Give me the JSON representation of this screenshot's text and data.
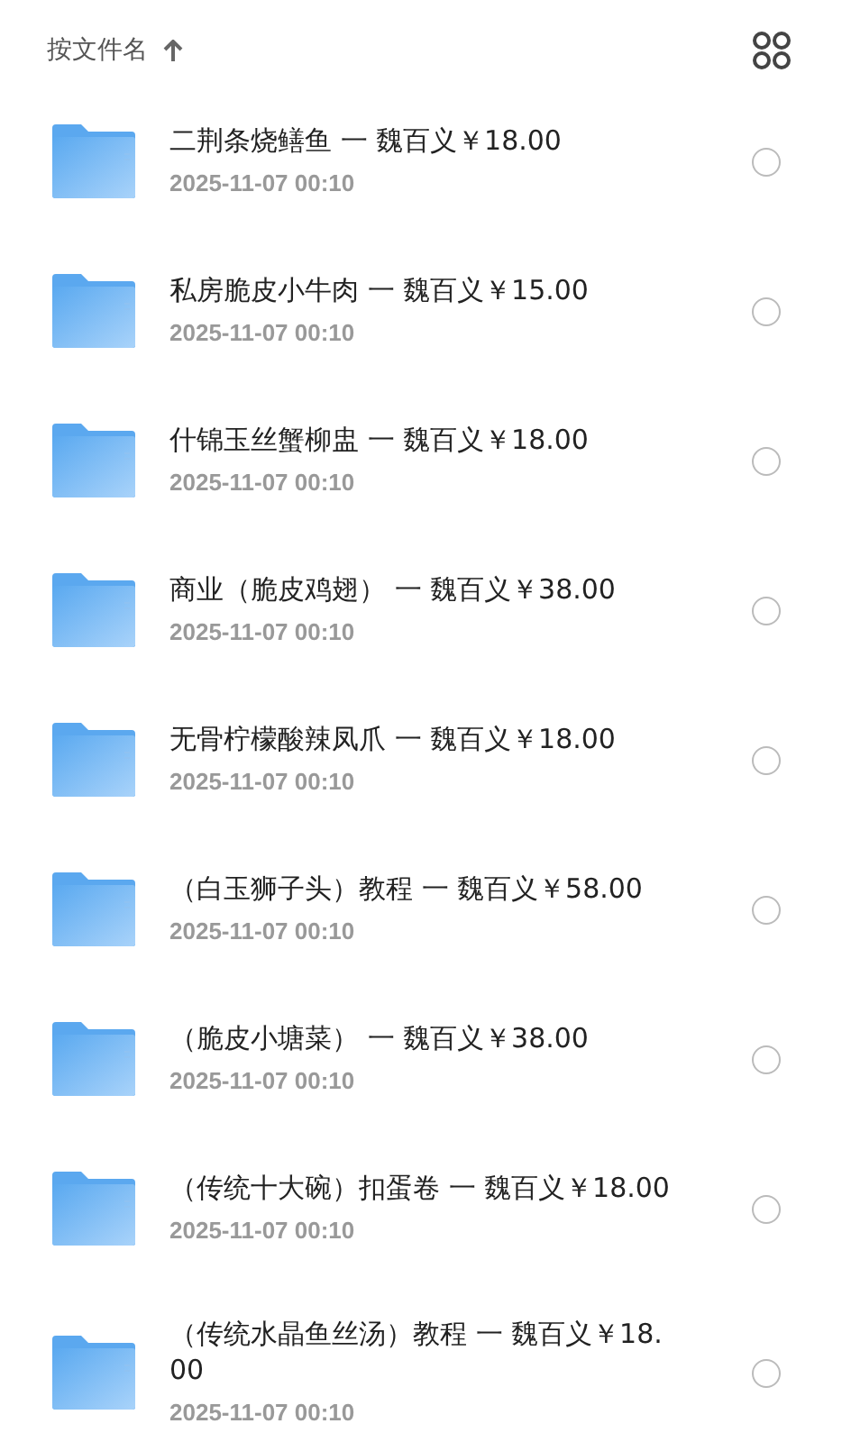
{
  "header": {
    "sort_label": "按文件名"
  },
  "files": [
    {
      "name": "二荆条烧鳝鱼 一 魏百义￥18.00",
      "date": "2025-11-07 00:10",
      "selected": false
    },
    {
      "name": "私房脆皮小牛肉 一 魏百义￥15.00",
      "date": "2025-11-07 00:10",
      "selected": false
    },
    {
      "name": "什锦玉丝蟹柳盅 一 魏百义￥18.00",
      "date": "2025-11-07 00:10",
      "selected": false
    },
    {
      "name": "商业（脆皮鸡翅） 一 魏百义￥38.00",
      "date": "2025-11-07 00:10",
      "selected": false
    },
    {
      "name": "无骨柠檬酸辣凤爪 一 魏百义￥18.00",
      "date": "2025-11-07 00:10",
      "selected": false
    },
    {
      "name": "（白玉狮子头）教程 一 魏百义￥58.00",
      "date": "2025-11-07 00:10",
      "selected": false
    },
    {
      "name": "（脆皮小塘菜） 一 魏百义￥38.00",
      "date": "2025-11-07 00:10",
      "selected": false
    },
    {
      "name": "（传统十大碗）扣蛋卷 一 魏百义￥18.00",
      "date": "2025-11-07 00:10",
      "selected": false
    },
    {
      "name": "（传统水晶鱼丝汤）教程 一 魏百义￥18.00",
      "date": "2025-11-07 00:10",
      "selected": false
    }
  ]
}
